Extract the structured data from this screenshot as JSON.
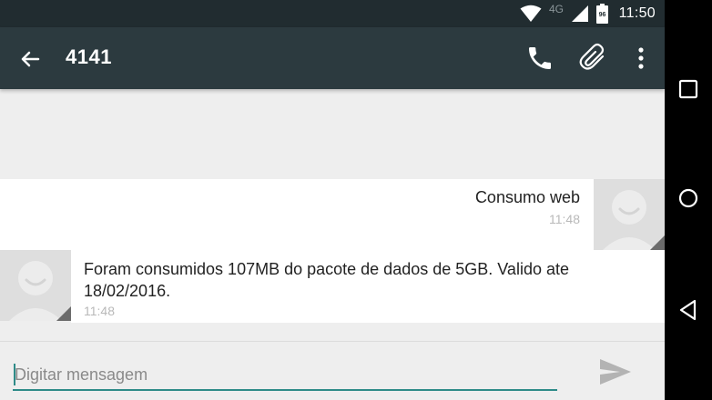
{
  "status_bar": {
    "network_type": "4G",
    "battery_level": "96",
    "time": "11:50",
    "icons": [
      "wifi-icon",
      "cell-signal-icon",
      "battery-icon"
    ]
  },
  "toolbar": {
    "title": "4141",
    "icons": [
      "back-arrow-icon",
      "phone-icon",
      "paperclip-icon",
      "more-vert-icon"
    ]
  },
  "messages": [
    {
      "direction": "outgoing",
      "text": "Consumo web",
      "time": "11:48"
    },
    {
      "direction": "incoming",
      "text": "Foram consumidos 107MB do pacote de dados de 5GB. Valido ate 18/02/2016.",
      "time": "11:48"
    }
  ],
  "compose": {
    "placeholder": "Digitar mensagem",
    "value": ""
  },
  "nav_bar": {
    "icons": [
      "recents-icon",
      "home-icon",
      "back-icon"
    ]
  },
  "colors": {
    "toolbar": "#2c3a3f",
    "status_bar": "#212c30",
    "accent": "#2e8b88",
    "background": "#eeeeee",
    "bubble": "#ffffff"
  }
}
